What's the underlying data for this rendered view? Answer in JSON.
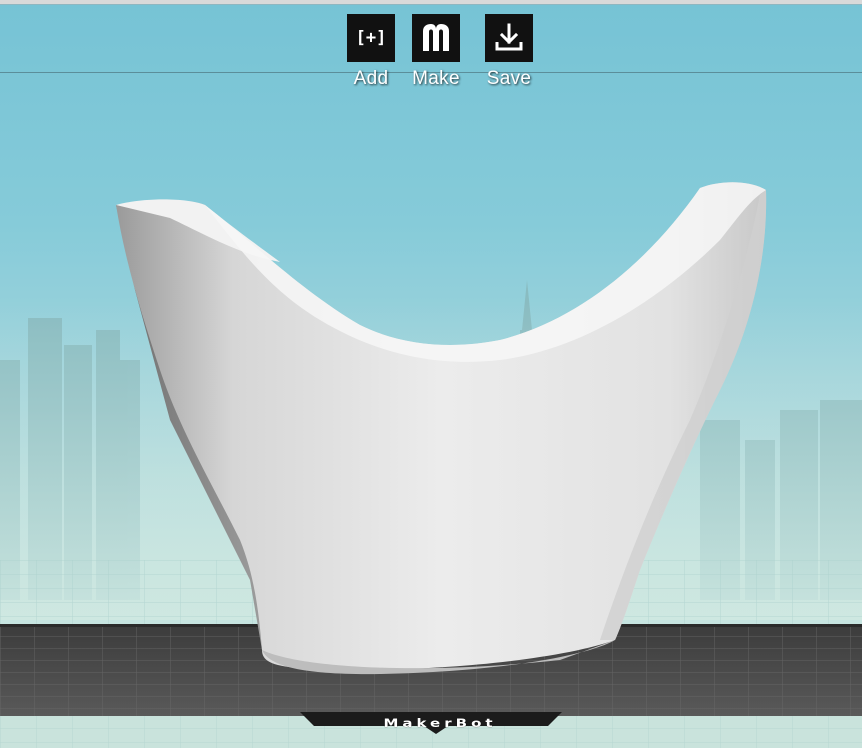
{
  "toolbar": {
    "add": {
      "label": "Add",
      "icon": "add-bracket-icon",
      "glyph": "[+]"
    },
    "make": {
      "label": "Make",
      "icon": "makerbot-m-icon"
    },
    "save": {
      "label": "Save",
      "icon": "download-icon"
    }
  },
  "build_plate": {
    "brand": "MakerBot"
  },
  "colors": {
    "sky_top": "#76c3d5",
    "sky_bottom": "#cfe8e1",
    "plate": "#4d4d4d",
    "model": "#e8e8e8",
    "button": "#111111"
  }
}
